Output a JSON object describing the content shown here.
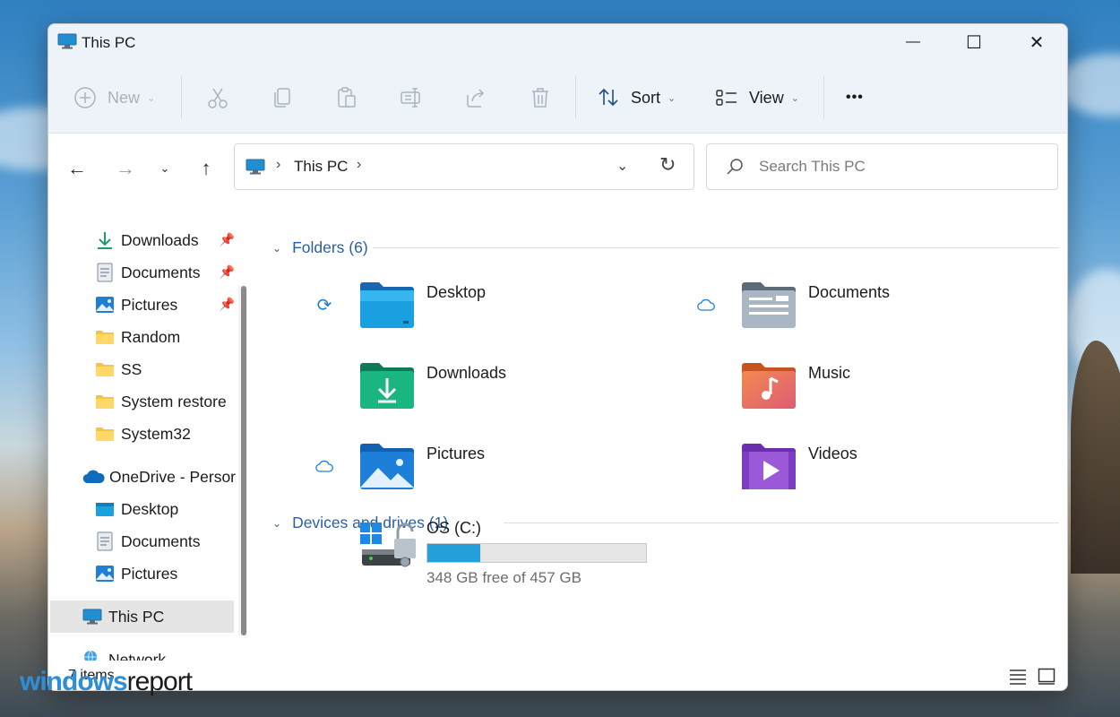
{
  "window": {
    "title": "This PC",
    "controls": {
      "minimize": "—",
      "maximize": "☐",
      "close": "✕"
    }
  },
  "toolbar": {
    "new_label": "New",
    "sort_label": "Sort",
    "view_label": "View",
    "more_label": "•••"
  },
  "address": {
    "path": "This PC",
    "separator": "›"
  },
  "search": {
    "placeholder": "Search This PC"
  },
  "sidebar": {
    "items": [
      {
        "label": "Downloads",
        "icon": "download-icon"
      },
      {
        "label": "Documents",
        "icon": "document-icon"
      },
      {
        "label": "Pictures",
        "icon": "picture-icon"
      },
      {
        "label": "Random",
        "icon": "folder-icon"
      },
      {
        "label": "SS",
        "icon": "folder-icon"
      },
      {
        "label": "System restore",
        "icon": "folder-icon"
      },
      {
        "label": "System32",
        "icon": "folder-icon"
      },
      {
        "label": "OneDrive - Persor",
        "icon": "onedrive-cloud-icon"
      },
      {
        "label": "Desktop",
        "icon": "desktop-folder-icon"
      },
      {
        "label": "Documents",
        "icon": "document-icon"
      },
      {
        "label": "Pictures",
        "icon": "picture-icon"
      },
      {
        "label": "This PC",
        "icon": "monitor-icon"
      },
      {
        "label": "Network",
        "icon": "network-icon"
      }
    ]
  },
  "main": {
    "folders_heading": "Folders (6)",
    "devices_heading": "Devices and drives (1)",
    "folders": [
      {
        "label": "Desktop",
        "status": "sync-icon"
      },
      {
        "label": "Documents",
        "status": "cloud-icon"
      },
      {
        "label": "Downloads",
        "status": ""
      },
      {
        "label": "Music",
        "status": ""
      },
      {
        "label": "Pictures",
        "status": "cloud-icon"
      },
      {
        "label": "Videos",
        "status": ""
      }
    ],
    "drive": {
      "name": "OS (C:)",
      "free_text": "348 GB free of 457 GB",
      "used_fraction": 0.24
    }
  },
  "statusbar": {
    "count": "7 items"
  },
  "watermark": {
    "part1": "windows",
    "part2": "report"
  },
  "colors": {
    "accent": "#2a5fa4",
    "drive_fill": "#26a0da",
    "toolbar_bg": "#eef3f9"
  }
}
